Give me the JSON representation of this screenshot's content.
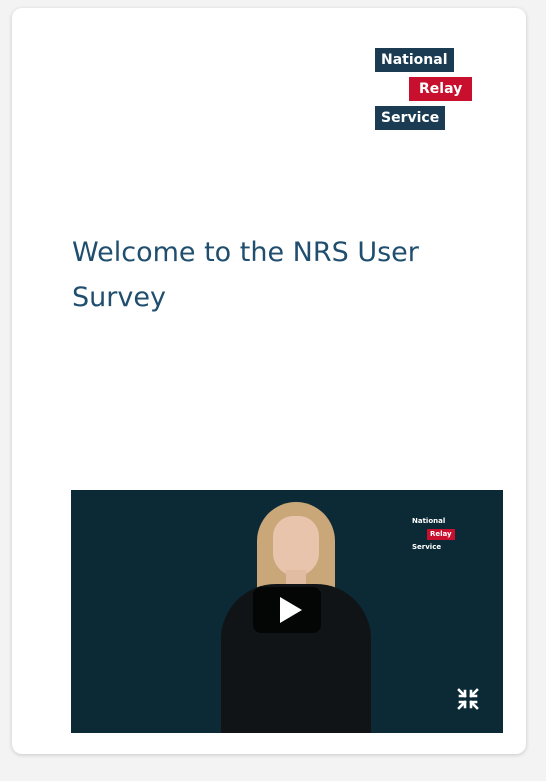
{
  "logo": {
    "line1": "National",
    "line2": "Relay",
    "line3": "Service"
  },
  "survey": {
    "title": "Welcome to the NRS User Survey"
  },
  "video": {
    "watermark": {
      "line1": "National",
      "line2": "Relay",
      "line3": "Service"
    },
    "icons": {
      "play": "play-icon",
      "fullscreen": "fullscreen-icon"
    }
  },
  "colors": {
    "brand_navy": "#1a3b52",
    "brand_red": "#c8102e",
    "title_blue": "#1f4e6e",
    "video_bg": "#0c2a36"
  }
}
